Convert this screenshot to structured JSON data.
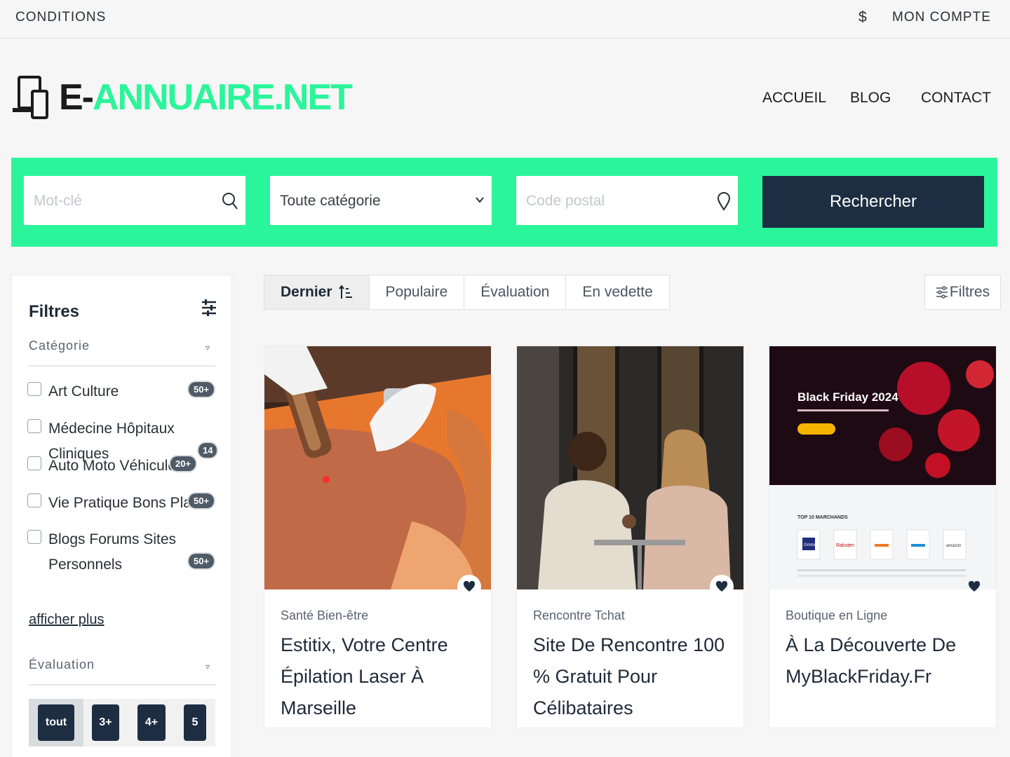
{
  "topbar": {
    "conditions": "CONDITIONS",
    "currency": "$",
    "account": "MON COMPTE"
  },
  "brand": {
    "prefix": "E-",
    "name": "ANNUAIRE.NET"
  },
  "nav": [
    {
      "label": "ACCUEIL"
    },
    {
      "label": "BLOG"
    },
    {
      "label": "CONTACT"
    }
  ],
  "search": {
    "keyword_placeholder": "Mot-clé",
    "category_value": "Toute catégorie",
    "postal_placeholder": "Code postal",
    "submit_label": "Rechercher"
  },
  "sidebar": {
    "title": "Filtres",
    "category_header": "Catégorie",
    "categories": [
      {
        "name": "Art Culture",
        "count": "50+"
      },
      {
        "name": "Médecine Hôpitaux Cliniques",
        "count": "14"
      },
      {
        "name": "Auto Moto Véhicule",
        "count": "20+"
      },
      {
        "name": "Vie Pratique Bons Plans",
        "count": "50+"
      },
      {
        "name": "Blogs Forums Sites Personnels",
        "count": "50+"
      }
    ],
    "show_more": "afficher plus",
    "rating_header": "Évaluation",
    "ratings": [
      "tout",
      "3+",
      "4+",
      "5"
    ]
  },
  "sort_tabs": [
    {
      "label": "Dernier",
      "active": true
    },
    {
      "label": "Populaire"
    },
    {
      "label": "Évaluation"
    },
    {
      "label": "En vedette"
    }
  ],
  "filters_button": "Filtres",
  "listings": [
    {
      "category": "Santé Bien-être",
      "title": "Estitix, Votre Centre Épilation Laser À Marseille"
    },
    {
      "category": "Rencontre Tchat",
      "title": "Site De Rencontre 100 % Gratuit Pour Célibataires"
    },
    {
      "category": "Boutique en Ligne",
      "title": "À La Découverte De MyBlackFriday.Fr",
      "image_text": {
        "headline": "Black Friday 2024",
        "section": "TOP 10 MARCHANDS",
        "brands": [
          "Gmmd",
          "Rakuten",
          "",
          "",
          "amazon"
        ]
      }
    }
  ],
  "colors": {
    "accent": "#2bf59a",
    "navy": "#1e2e42"
  }
}
